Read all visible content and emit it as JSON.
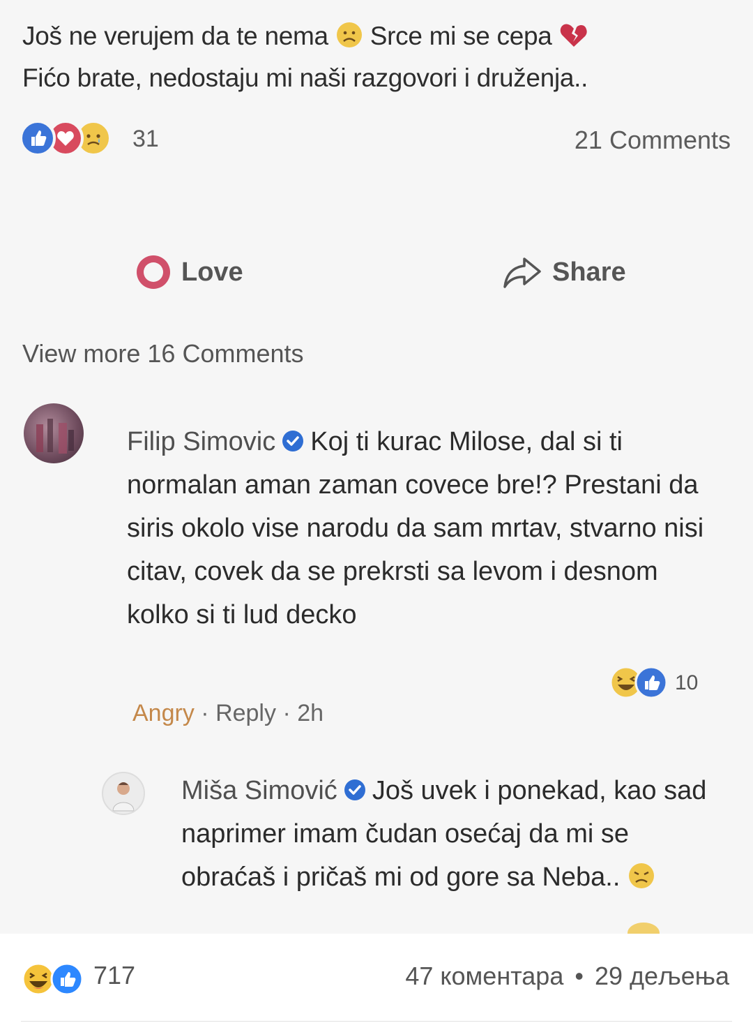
{
  "post": {
    "line1_a": "Još ne verujem da te nema",
    "line1_b": "Srce mi se cepa",
    "line2": "Fićo brate, nedostaju mi naši razgovori i druženja.."
  },
  "reactions": {
    "count": "31",
    "comments": "21 Comments"
  },
  "actions": {
    "love": "Love",
    "share": "Share"
  },
  "view_more": "View more 16 Comments",
  "comment1": {
    "author": "Filip Simovic",
    "text": "Koj ti kurac Milose, dal si ti normalan aman zaman covece bre!? Prestani da siris okolo vise narodu da sam mrtav, stvarno nisi citav, covek da se prekrsti sa levom i desnom kolko si ti lud decko",
    "reaction_count": "10",
    "meta_angry": "Angry",
    "meta_reply": "Reply",
    "meta_time": "2h"
  },
  "comment2": {
    "author": "Miša Simović",
    "text": "Još uvek i ponekad, kao sad naprimer imam čudan osećaj da mi se obraćaš i pričaš mi od gore sa Neba.."
  },
  "footer": {
    "reaction_count": "717",
    "comments": "47 коментара",
    "separator": "•",
    "shares": "29 дељења"
  },
  "colors": {
    "like_blue": "#3b74d8",
    "love_red": "#d84a5e",
    "sad_yellow": "#f0c64a",
    "angry_orange": "#c4884a",
    "verified_blue": "#2f6ed3"
  }
}
